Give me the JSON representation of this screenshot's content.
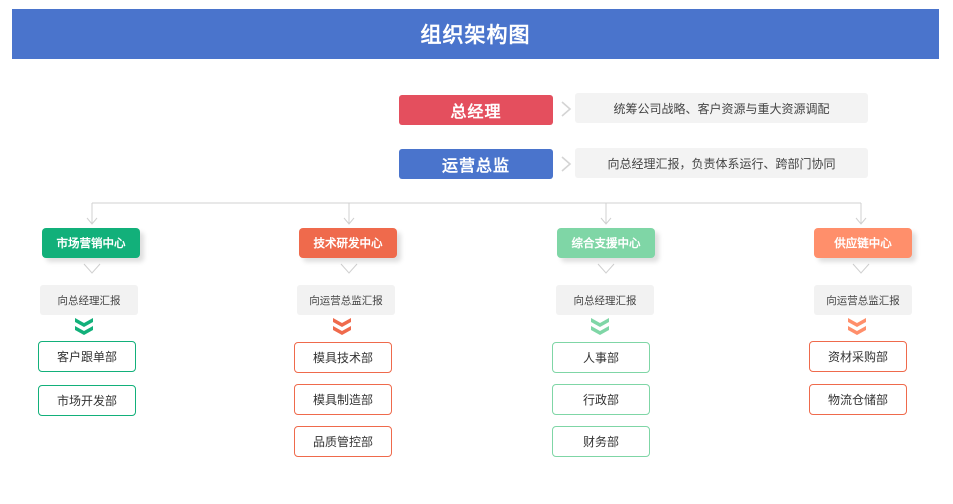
{
  "title": "组织架构图",
  "executives": [
    {
      "title": "总经理",
      "description": "统筹公司战略、客户资源与重大资源调配"
    },
    {
      "title": "运营总监",
      "description": "向总经理汇报，负责体系运行、跨部门协同"
    }
  ],
  "centers": [
    {
      "name": "市场营销中心",
      "report": "向总经理汇报",
      "color": "#12b07a",
      "depts": [
        "客户跟单部",
        "市场开发部"
      ]
    },
    {
      "name": "技术研发中心",
      "report": "向运营总监汇报",
      "color": "#ef6a4c",
      "depts": [
        "模具技术部",
        "模具制造部",
        "品质管控部"
      ]
    },
    {
      "name": "综合支援中心",
      "report": "向总经理汇报",
      "color": "#7fd6a6",
      "depts": [
        "人事部",
        "行政部",
        "财务部"
      ]
    },
    {
      "name": "供应链中心",
      "report": "向运营总监汇报",
      "color": "#ff8f6b",
      "depts": [
        "资材采购部",
        "物流仓储部"
      ]
    }
  ]
}
